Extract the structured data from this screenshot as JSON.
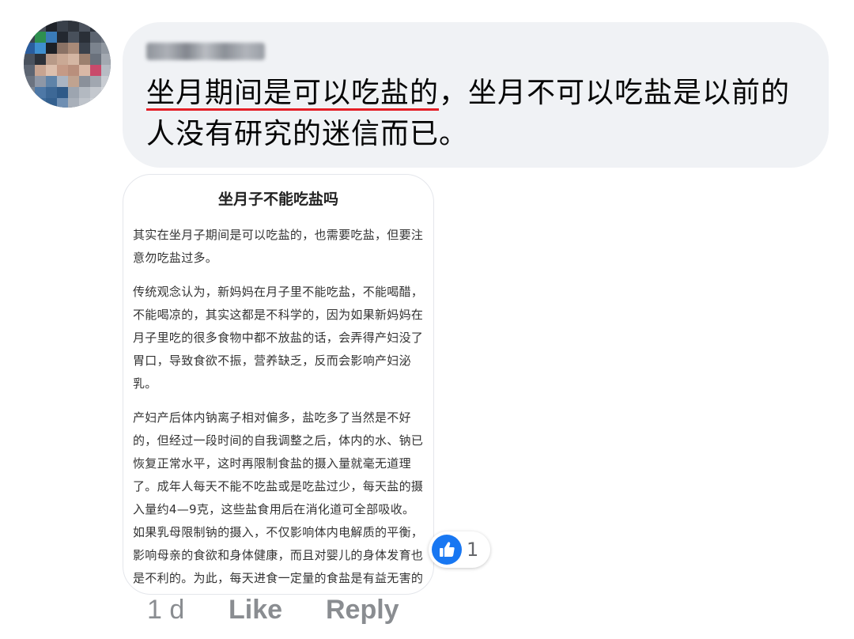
{
  "comment": {
    "text_underlined": "坐月期间是可以吃盐的",
    "text_rest": "，坐月不可以吃盐是以前的人没有研究的迷信而已。"
  },
  "attachment": {
    "title": "坐月子不能吃盐吗",
    "paragraphs": [
      "其实在坐月子期间是可以吃盐的，也需要吃盐，但要注意勿吃盐过多。",
      "传统观念认为，新妈妈在月子里不能吃盐，不能喝醋，不能喝凉的，其实这都是不科学的，因为如果新妈妈在月子里吃的很多食物中都不放盐的话，会弄得产妇没了胃口，导致食欲不振，营养缺乏，反而会影响产妇泌乳。",
      "产妇产后体内钠离子相对偏多，盐吃多了当然是不好的，但经过一段时间的自我调整之后，体内的水、钠已恢复正常水平，这时再限制食盐的摄入量就毫无道理了。成年人每天不能不吃盐或是吃盐过少，每天盐的摄入量约4—9克，这些盐食用后在消化道可全部吸收。如果乳母限制钠的摄入，不仅影响体内电解质的平衡，影响母亲的食欲和身体健康，而且对婴儿的身体发育也是不利的。为此，每天进食一定量的食盐是有益无害的"
    ]
  },
  "reaction": {
    "icon": "thumbs-up-icon",
    "count": "1",
    "color": "#1877f2"
  },
  "actions": {
    "timestamp": "1 d",
    "like_label": "Like",
    "reply_label": "Reply"
  }
}
